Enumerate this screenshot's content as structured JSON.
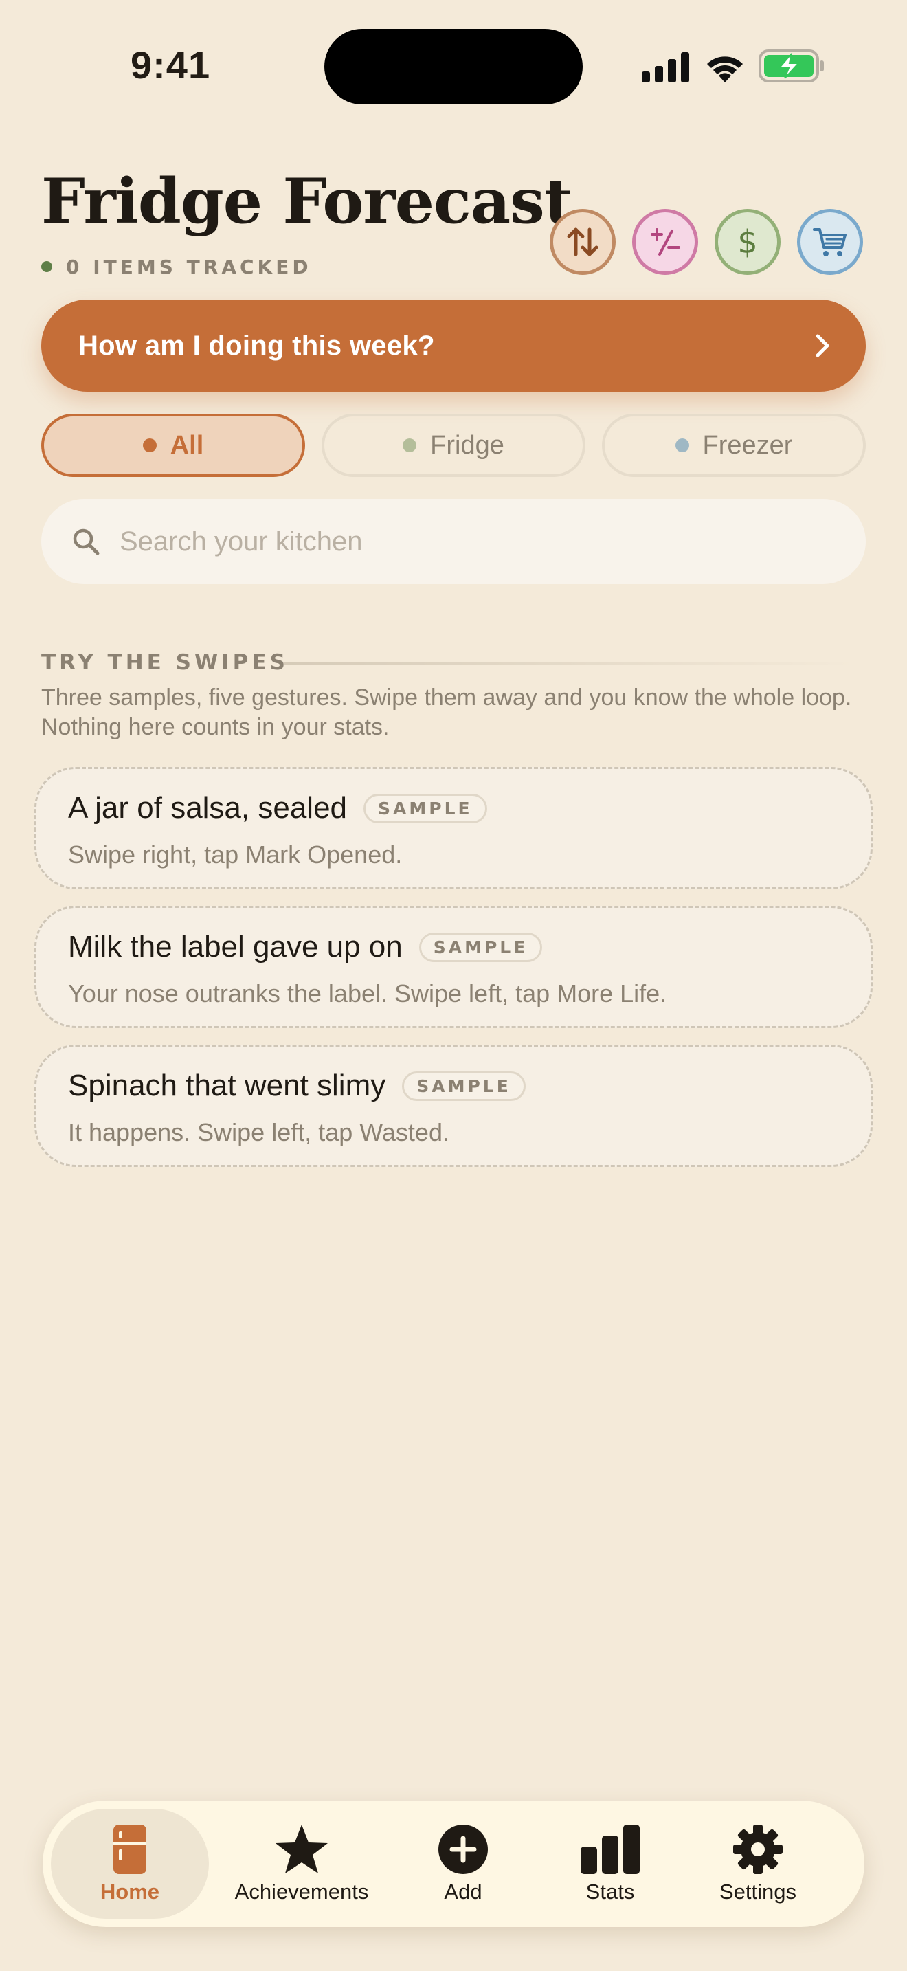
{
  "status_bar": {
    "time": "9:41"
  },
  "header": {
    "title": "Fridge Forecast",
    "items_tracked": "0 ITEMS TRACKED",
    "colors": {
      "accent": "#c56e38",
      "tracked_dot": "#5f7f48"
    },
    "action_icons": [
      "sort-arrows-icon",
      "plus-minus-icon",
      "dollar-icon",
      "cart-icon"
    ]
  },
  "banner": {
    "label": "How am I doing this week?"
  },
  "filters": {
    "all": "All",
    "fridge": "Fridge",
    "freezer": "Freezer",
    "selected": "All"
  },
  "search": {
    "placeholder": "Search your kitchen",
    "value": ""
  },
  "swipes": {
    "heading": "TRY THE SWIPES",
    "description": "Three samples, five gestures. Swipe them away and you know the whole loop. Nothing here counts in your stats.",
    "cards": [
      {
        "title": "A jar of salsa, sealed",
        "badge": "SAMPLE",
        "hint": "Swipe right, tap Mark Opened."
      },
      {
        "title": "Milk the label gave up on",
        "badge": "SAMPLE",
        "hint": "Your nose outranks the label. Swipe left, tap More Life."
      },
      {
        "title": "Spinach that went slimy",
        "badge": "SAMPLE",
        "hint": "It happens. Swipe left, tap Wasted."
      }
    ]
  },
  "nav": {
    "home": "Home",
    "achievements": "Achievements",
    "add": "Add",
    "stats": "Stats",
    "settings": "Settings",
    "active": "Home"
  }
}
